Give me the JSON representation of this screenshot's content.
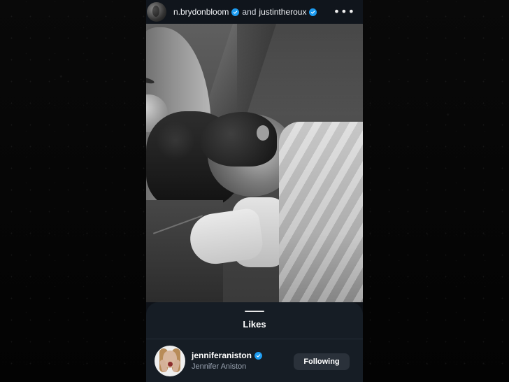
{
  "header": {
    "user1": "n.brydonbloom",
    "conjunction": "and",
    "user2": "justintheroux",
    "more_icon": "•••"
  },
  "sheet": {
    "title": "Likes"
  },
  "likes": [
    {
      "username": "jenniferaniston",
      "name": "Jennifer Aniston",
      "button_label": "Following"
    }
  ],
  "icons": {
    "verified": "verified-icon",
    "more": "more-icon"
  },
  "colors": {
    "verified": "#1d9bf0",
    "background": "#050505",
    "sheet": "#161d25"
  }
}
